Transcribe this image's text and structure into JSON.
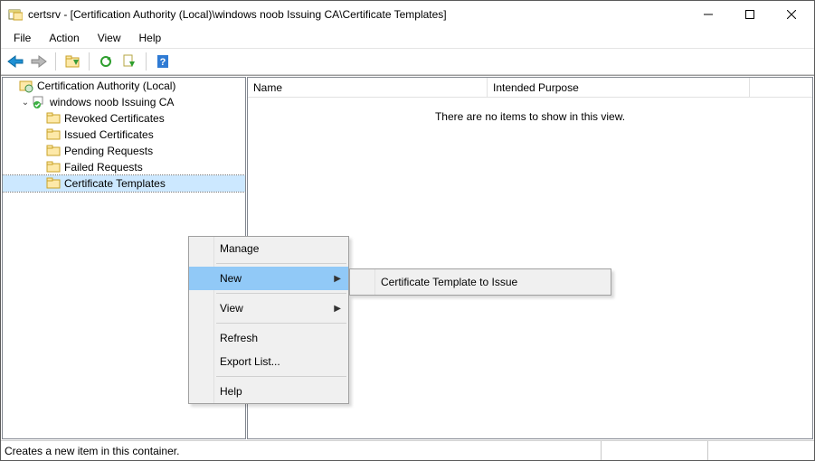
{
  "window": {
    "title": "certsrv - [Certification Authority (Local)\\windows noob Issuing CA\\Certificate Templates]"
  },
  "menubar": {
    "file": "File",
    "action": "Action",
    "view": "View",
    "help": "Help"
  },
  "tree": {
    "root": "Certification Authority (Local)",
    "ca": "windows noob Issuing CA",
    "children": {
      "revoked": "Revoked Certificates",
      "issued": "Issued Certificates",
      "pending": "Pending Requests",
      "failed": "Failed Requests",
      "templates": "Certificate Templates"
    }
  },
  "list": {
    "cols": {
      "name": "Name",
      "purpose": "Intended Purpose"
    },
    "empty": "There are no items to show in this view."
  },
  "context_menu": {
    "manage": "Manage",
    "new": "New",
    "view": "View",
    "refresh": "Refresh",
    "export": "Export List...",
    "help": "Help"
  },
  "submenu": {
    "issue": "Certificate Template to Issue"
  },
  "statusbar": {
    "text": "Creates a new item in this container."
  }
}
